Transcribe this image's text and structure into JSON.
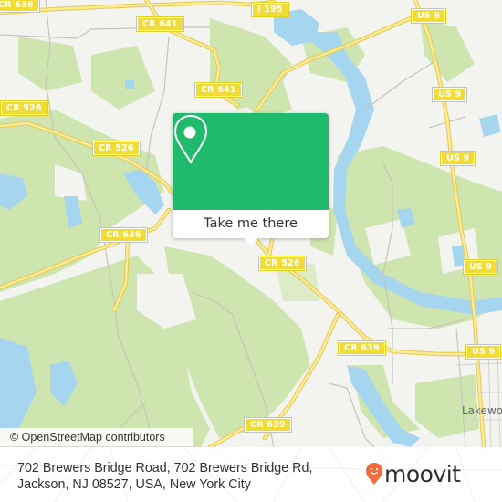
{
  "map": {
    "colors": {
      "background": "#f3f3ef",
      "forest": "#cfe5b0",
      "water": "#a6d6ef",
      "road": "#f5e27a",
      "minor_road": "#c8c4bc",
      "shield": "#f1dc36"
    },
    "route_shields": [
      {
        "id": "cr-636-top",
        "label": "CR 636"
      },
      {
        "id": "cr-641-a",
        "label": "CR 641"
      },
      {
        "id": "i-195",
        "label": "I 195"
      },
      {
        "id": "us-9-a",
        "label": "US 9"
      },
      {
        "id": "cr-641-b",
        "label": "CR 641"
      },
      {
        "id": "cr-526-a",
        "label": "CR 526"
      },
      {
        "id": "us-9-b",
        "label": "US 9"
      },
      {
        "id": "cr-526-b",
        "label": "CR 526"
      },
      {
        "id": "us-9-c",
        "label": "US 9"
      },
      {
        "id": "cr-636",
        "label": "CR 636"
      },
      {
        "id": "cr-526-c",
        "label": "CR 526"
      },
      {
        "id": "us-9-d",
        "label": "US 9"
      },
      {
        "id": "cr-639-a",
        "label": "CR 639"
      },
      {
        "id": "us-9-e",
        "label": "US 9"
      },
      {
        "id": "cr-639-b",
        "label": "CR 639"
      }
    ],
    "place_labels": [
      {
        "id": "lakewood",
        "label": "Lakewo"
      }
    ],
    "attribution": "© OpenStreetMap contributors"
  },
  "popup": {
    "icon": "map-pin-icon",
    "button_label": "Take me there"
  },
  "footer": {
    "address_line1": "702 Brewers Bridge Road, 702 Brewers Bridge Rd,",
    "address_line2": "Jackson, NJ 08527, USA, New York City",
    "brand": {
      "icon": "moovit-pin-icon",
      "name": "moovit",
      "color": "#f26b3a"
    }
  }
}
